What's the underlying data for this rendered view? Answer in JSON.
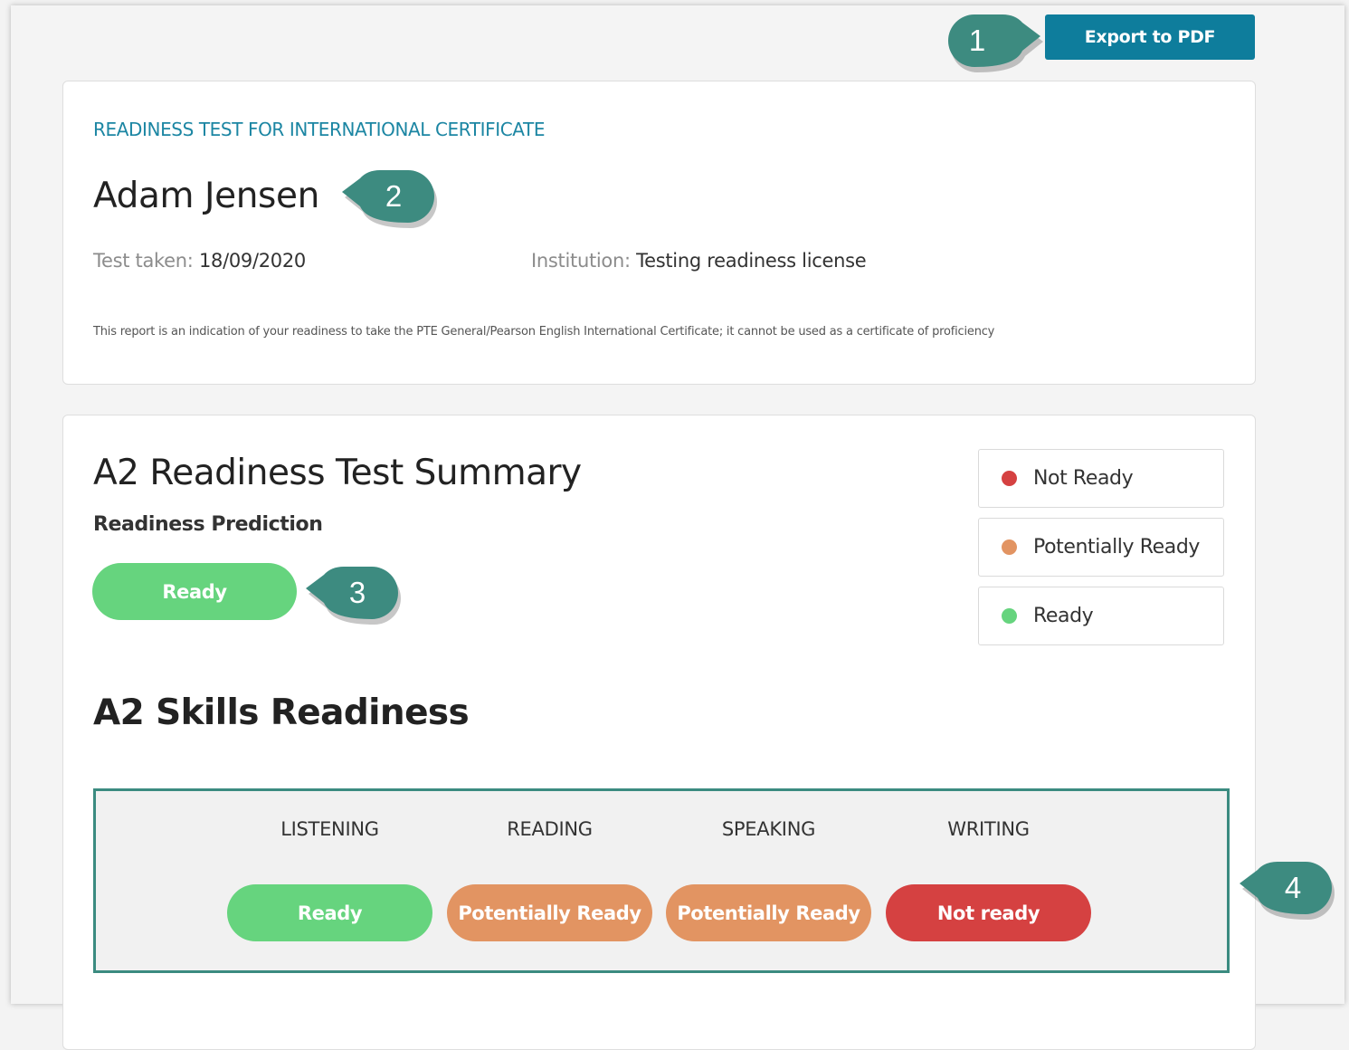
{
  "toolbar": {
    "export_label": "Export to PDF"
  },
  "header": {
    "test_name": "READINESS TEST FOR INTERNATIONAL CERTIFICATE",
    "candidate_name": "Adam Jensen",
    "test_taken_label": "Test taken:",
    "test_taken_value": "18/09/2020",
    "institution_label": "Institution:",
    "institution_value": "Testing readiness license",
    "disclaimer": "This report is an indication of your readiness to take the PTE General/Pearson English International Certificate; it cannot be used as a certificate of proficiency"
  },
  "summary": {
    "title": "A2 Readiness Test Summary",
    "prediction_label": "Readiness Prediction",
    "prediction_value": "Ready",
    "prediction_color": "#66d47e"
  },
  "legend": [
    {
      "label": "Not Ready",
      "color": "#d54141"
    },
    {
      "label": "Potentially Ready",
      "color": "#e29462"
    },
    {
      "label": "Ready",
      "color": "#66d47e"
    }
  ],
  "skills": {
    "title": "A2 Skills Readiness",
    "items": [
      {
        "name": "LISTENING",
        "status": "Ready",
        "color": "#66d47e"
      },
      {
        "name": "READING",
        "status": "Potentially Ready",
        "color": "#e29462"
      },
      {
        "name": "SPEAKING",
        "status": "Potentially Ready",
        "color": "#e29462"
      },
      {
        "name": "WRITING",
        "status": "Not ready",
        "color": "#d54141"
      }
    ]
  },
  "callouts": [
    {
      "number": "1",
      "color": "#3d8b80"
    },
    {
      "number": "2",
      "color": "#3d8b80"
    },
    {
      "number": "3",
      "color": "#3d8b80"
    },
    {
      "number": "4",
      "color": "#3d8b80"
    }
  ]
}
